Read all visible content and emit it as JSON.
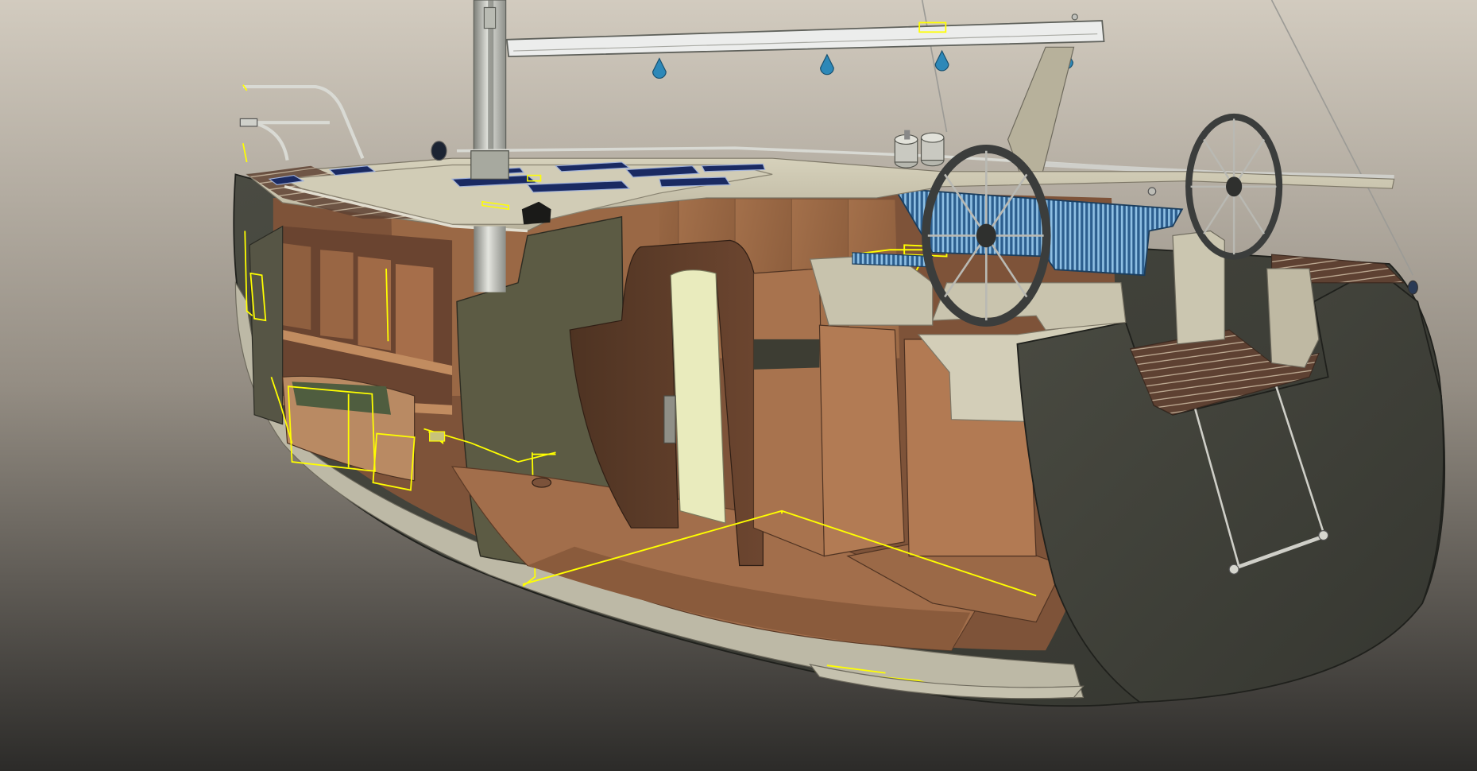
{
  "colors": {
    "background_top": "#d2cbbf",
    "background_bottom": "#2c2b29",
    "hull_dark": "#41423a",
    "hull_edge": "#bcb9a6",
    "deck_cream": "#cdc7b1",
    "deck_shadow": "#a9a392",
    "wood_light": "#a8734e",
    "wood_mid": "#8d5e3d",
    "wood_dark": "#5b3a26",
    "teak_deck": "#5e4132",
    "bulkhead_olive": "#5b5a44",
    "companionway_yellow": "#e9ebbd",
    "cushion_blue": "#3f7fb3",
    "fitting_blue": "#2d88b8",
    "hatch_navy": "#17245a",
    "construction_yellow": "#ffff00",
    "wheel_grey": "#3b3d3c",
    "mast_grey": "#c7c9c2",
    "boom_white": "#ecedec",
    "winch_grey": "#c9c9c1",
    "stay_line": "#9c9b96"
  },
  "icons": {
    "mast": "mast-icon",
    "boom": "boom-icon",
    "wheel": "steering-wheel-icon",
    "winch": "winch-icon",
    "block": "block-icon",
    "hatch": "deck-hatch-icon"
  }
}
